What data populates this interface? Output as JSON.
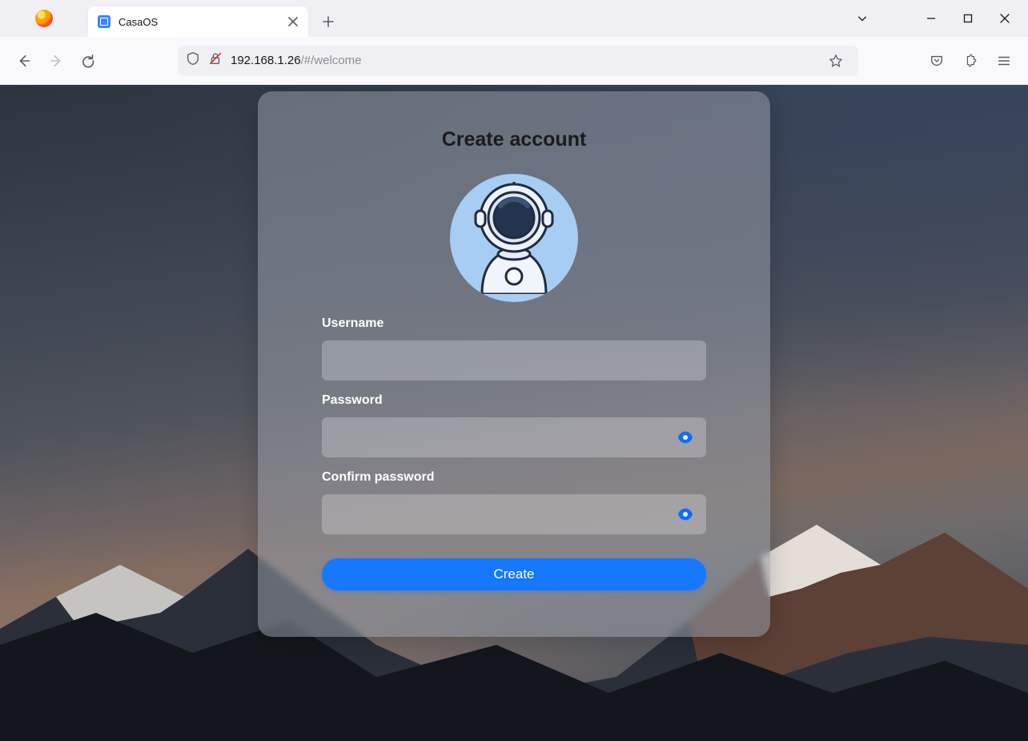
{
  "browser": {
    "tab_title": "CasaOS",
    "url_host": "192.168.1.26",
    "url_path": "/#/welcome"
  },
  "page": {
    "heading": "Create account",
    "labels": {
      "username": "Username",
      "password": "Password",
      "confirm_password": "Confirm password"
    },
    "fields": {
      "username": "",
      "password": "",
      "confirm_password": ""
    },
    "submit_label": "Create"
  }
}
